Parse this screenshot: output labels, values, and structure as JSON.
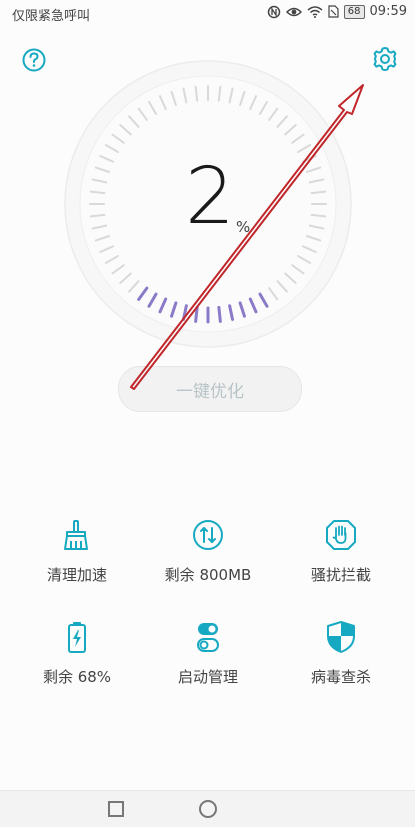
{
  "status_bar": {
    "left_text": "仅限紧急呼叫",
    "battery": "68",
    "time": "09:59"
  },
  "top": {
    "help_icon": "question-circle-icon",
    "settings_icon": "gear-icon"
  },
  "main": {
    "score": "2",
    "score_unit": "%",
    "optimize_label": "一键优化"
  },
  "grid": [
    {
      "label": "清理加速",
      "icon": "broom-icon"
    },
    {
      "label": "剩余 800MB",
      "icon": "memory-arrows-icon"
    },
    {
      "label": "骚扰拦截",
      "icon": "hand-shield-icon"
    },
    {
      "label": "剩余 68%",
      "icon": "battery-icon"
    },
    {
      "label": "启动管理",
      "icon": "toggle-icon"
    },
    {
      "label": "病毒查杀",
      "icon": "shield-icon"
    }
  ],
  "colors": {
    "accent": "#17a9c1",
    "annotation": "#c0262a",
    "dial_active": "#8a7ac8",
    "dial_inactive": "#d9d9d9"
  }
}
